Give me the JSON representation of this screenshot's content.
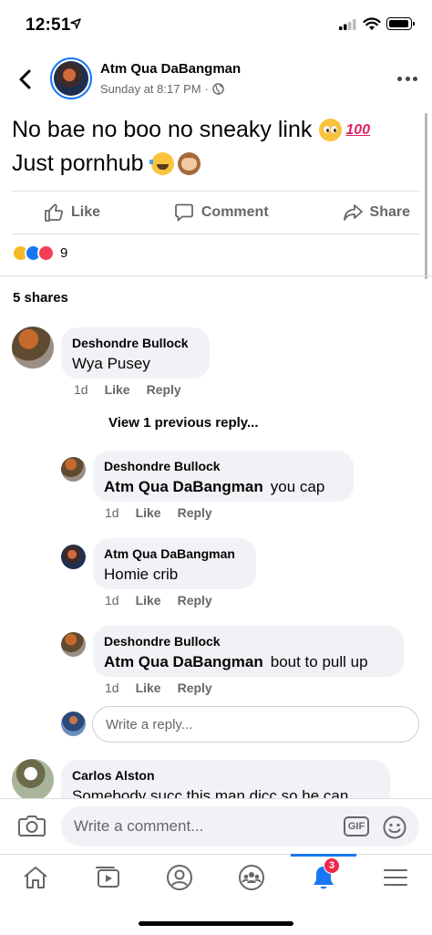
{
  "status_bar": {
    "time": "12:51"
  },
  "post": {
    "author": "Atm Qua DaBangman",
    "time": "Sunday at 8:17 PM",
    "privacy_icon": "globe-icon",
    "text_line1": "No bae no boo no sneaky link",
    "text_line2": "Just pornhub",
    "emojis_line1": [
      "pleading-face",
      "hundred-points"
    ],
    "emojis_line2": [
      "face-with-tears-of-joy",
      "see-no-evil-monkey"
    ],
    "emoji_100_label": "100"
  },
  "actions": {
    "like": "Like",
    "comment": "Comment",
    "share": "Share"
  },
  "reactions": {
    "types": [
      "haha",
      "like",
      "love"
    ],
    "count": "9"
  },
  "shares": "5 shares",
  "comments": [
    {
      "author": "Deshondre Bullock",
      "text": "Wya Pusey",
      "time": "1d",
      "like": "Like",
      "reply": "Reply"
    }
  ],
  "view_previous": "View 1 previous reply...",
  "replies": [
    {
      "author": "Deshondre Bullock",
      "tag": "Atm Qua DaBangman",
      "text": "you cap",
      "time": "1d",
      "like": "Like",
      "reply": "Reply"
    },
    {
      "author": "Atm Qua DaBangman",
      "tag": "",
      "text": "Homie crib",
      "time": "1d",
      "like": "Like",
      "reply": "Reply"
    },
    {
      "author": "Deshondre Bullock",
      "tag": "Atm Qua DaBangman",
      "text": "bout to pull up",
      "time": "1d",
      "like": "Like",
      "reply": "Reply"
    }
  ],
  "reply_input": {
    "placeholder": "Write a reply..."
  },
  "next_comment": {
    "author": "Carlos Alston",
    "text": "Somebody succ this man dicc so he can"
  },
  "composer": {
    "placeholder": "Write a comment...",
    "gif_label": "GIF"
  },
  "tabbar": {
    "notifications_badge": "3"
  },
  "colors": {
    "accent": "#1877f2",
    "bubble": "#f0f2f5",
    "muted": "#65676b",
    "badge": "#f02849"
  }
}
